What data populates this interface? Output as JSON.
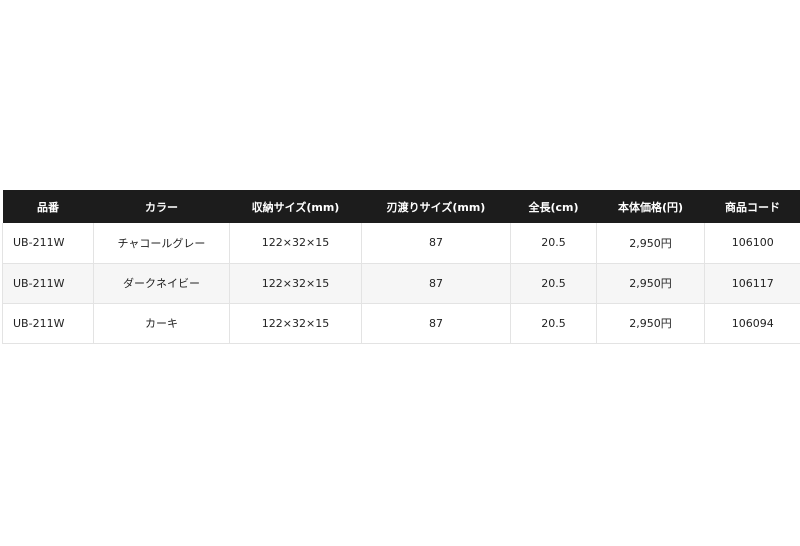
{
  "table": {
    "headers": [
      "品番",
      "カラー",
      "収納サイズ(mm)",
      "刃渡りサイズ(mm)",
      "全長(cm)",
      "本体価格(円)",
      "商品コード"
    ],
    "rows": [
      [
        "UB-211W",
        "チャコールグレー",
        "122×32×15",
        "87",
        "20.5",
        "2,950円",
        "106100"
      ],
      [
        "UB-211W",
        "ダークネイビー",
        "122×32×15",
        "87",
        "20.5",
        "2,950円",
        "106117"
      ],
      [
        "UB-211W",
        "カーキ",
        "122×32×15",
        "87",
        "20.5",
        "2,950円",
        "106094"
      ]
    ]
  },
  "colors": {
    "header_bg": "#1c1c1c",
    "header_text": "#ffffff",
    "row_alt_bg": "#f6f6f6",
    "border": "#e3e3e3"
  }
}
